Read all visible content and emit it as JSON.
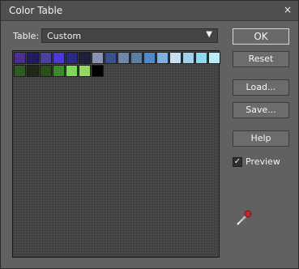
{
  "window": {
    "title": "Color Table",
    "close_glyph": "×"
  },
  "table": {
    "label": "Table:",
    "selected": "Custom",
    "arrow": "▼"
  },
  "buttons": {
    "ok": "OK",
    "reset": "Reset",
    "load": "Load...",
    "save": "Save...",
    "help": "Help"
  },
  "preview": {
    "label": "Preview",
    "checked": true,
    "mark": "✓"
  },
  "icons": {
    "eyedropper": "eyedropper-icon"
  },
  "swatches": [
    "#4a2f8f",
    "#1f1d5f",
    "#4b3fa0",
    "#4c38d6",
    "#2a2a86",
    "#1f1f3d",
    "#8b93b2",
    "#3a4f8e",
    "#6f86a4",
    "#5a7fa5",
    "#4f89c7",
    "#7fb0de",
    "#c9dff0",
    "#9fd1e8",
    "#8ed8f2",
    "#b8ecf7",
    "#2f5b22",
    "#1f2a16",
    "#2b4f1c",
    "#3b8a2a",
    "#7fd65a",
    "#93d85f",
    "#000000"
  ]
}
